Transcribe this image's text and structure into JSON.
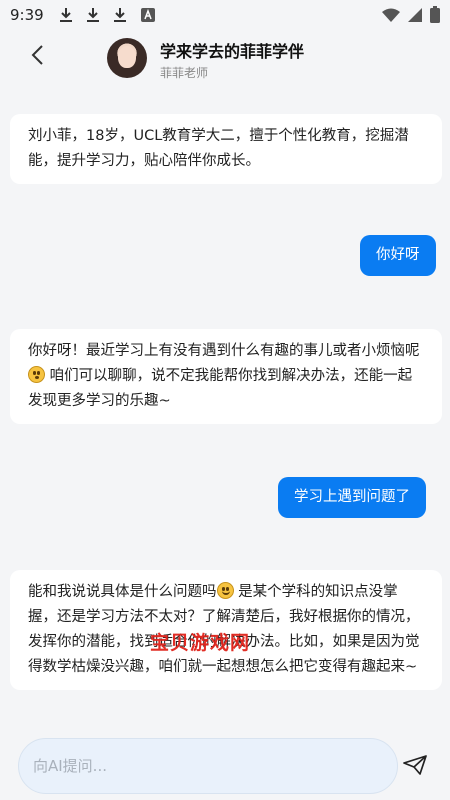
{
  "status_bar": {
    "time": "9:39",
    "icons": [
      "download-icon",
      "download-icon",
      "download-icon",
      "a-icon",
      "wifi-icon",
      "cellular-icon",
      "battery-icon"
    ]
  },
  "header": {
    "title": "学来学去的菲菲学伴",
    "subtitle": "菲菲老师"
  },
  "messages": [
    {
      "role": "bot",
      "text": "刘小菲，18岁，UCL教育学大二，擅于个性化教育，挖掘潜能，提升学习力，贴心陪伴你成长。"
    },
    {
      "role": "user",
      "text": "你好呀"
    },
    {
      "role": "bot",
      "text_before_emoji": "你好呀！最近学习上有没有遇到什么有趣的事儿或者小烦恼呢",
      "emoji": "dizzy-face-emoji",
      "text_after_emoji": " 咱们可以聊聊，说不定我能帮你找到解决办法，还能一起发现更多学习的乐趣~"
    },
    {
      "role": "user",
      "text": "学习上遇到问题了"
    },
    {
      "role": "bot",
      "text_before_emoji": "能和我说说具体是什么问题吗",
      "emoji": "grinning-face-emoji",
      "text_after_emoji": " 是某个学科的知识点没掌握，还是学习方法不太对？了解清楚后，我好根据你的情况，发挥你的潜能，找到适合你的解决办法。比如，如果是因为觉得数学枯燥没兴趣，咱们就一起想想怎么把它变得有趣起来~"
    }
  ],
  "watermark": "宝贝游戏网",
  "input": {
    "placeholder": "向AI提问...",
    "value": ""
  },
  "colors": {
    "accent": "#0a7cf2",
    "background": "#f4f5f7",
    "bot_bubble": "#ffffff",
    "watermark": "#e0231b"
  }
}
